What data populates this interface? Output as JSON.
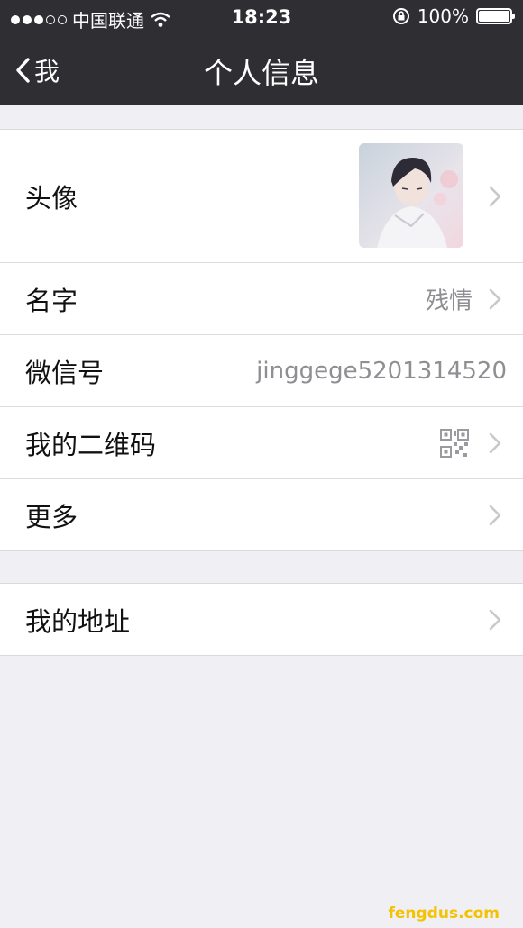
{
  "status_bar": {
    "carrier": "中国联通",
    "time": "18:23",
    "battery": "100%",
    "battery_level": 1.0,
    "signal_bars": 3,
    "signal_total": 5
  },
  "nav": {
    "back_label": "我",
    "title": "个人信息"
  },
  "profile": {
    "avatar_label": "头像",
    "name_label": "名字",
    "name_value": "残情",
    "wechat_id_label": "微信号",
    "wechat_id_value": "jinggege5201314520",
    "qr_label": "我的二维码",
    "more_label": "更多"
  },
  "address": {
    "label": "我的地址"
  },
  "watermark": "fengdus.com",
  "colors": {
    "nav_bg": "#2f2e33",
    "page_bg": "#efeff4",
    "value_text": "#8e8e93"
  }
}
